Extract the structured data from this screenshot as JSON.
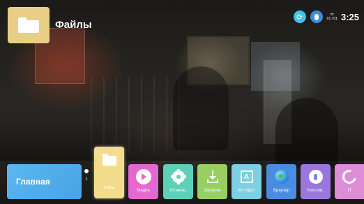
{
  "header": {
    "app_title": "Файлы",
    "app_icon": "folder-icon"
  },
  "status": {
    "refresh_icon": "refresh-icon",
    "mic_icon": "microphone-icon",
    "day_of_week": "пт",
    "date": "01 / 01",
    "time": "3:25"
  },
  "dock": {
    "home_label": "Главная",
    "page_number": "2",
    "focused_tile_label": "Файлы",
    "apps": [
      {
        "label": "Медиа",
        "icon": "play-icon",
        "color": "#e468cf"
      },
      {
        "label": "Установ..",
        "icon": "gear-icon",
        "color": "#5ed0b7"
      },
      {
        "label": "Загрузки",
        "icon": "download-icon",
        "color": "#97cf63"
      },
      {
        "label": "Мс Apps",
        "icon": "apps-icon",
        "color": "#7dcfe3"
      },
      {
        "label": "Браузер",
        "icon": "globe-icon",
        "color": "#4a8de0"
      },
      {
        "label": "Голосов..",
        "icon": "microphone-icon",
        "color": "#9a77de"
      },
      {
        "label": "П",
        "icon": "swirl-icon",
        "color": "#de8dd8"
      }
    ]
  },
  "colors": {
    "home_tile": "#4aa2e6",
    "focused_tile": "#f3dd8d",
    "app_header_tile": "#e9cf86"
  }
}
